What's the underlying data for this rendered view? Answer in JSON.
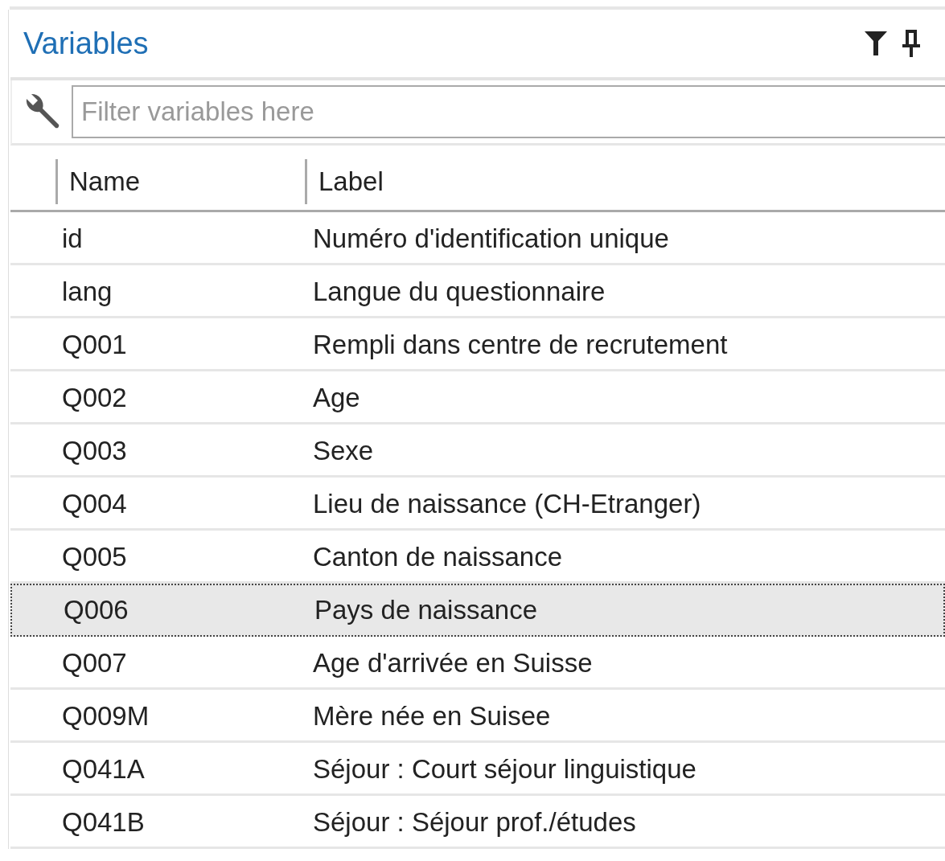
{
  "panel": {
    "title": "Variables"
  },
  "filter": {
    "placeholder": "Filter variables here"
  },
  "table": {
    "columns": [
      "Name",
      "Label"
    ],
    "rows": [
      {
        "name": "id",
        "label": "Numéro d'identification unique",
        "selected": false
      },
      {
        "name": "lang",
        "label": "Langue du questionnaire",
        "selected": false
      },
      {
        "name": "Q001",
        "label": "Rempli dans centre de recrutement",
        "selected": false
      },
      {
        "name": "Q002",
        "label": "Age",
        "selected": false
      },
      {
        "name": "Q003",
        "label": "Sexe",
        "selected": false
      },
      {
        "name": "Q004",
        "label": "Lieu de naissance (CH-Etranger)",
        "selected": false
      },
      {
        "name": "Q005",
        "label": "Canton de naissance",
        "selected": false
      },
      {
        "name": "Q006",
        "label": "Pays de naissance",
        "selected": true
      },
      {
        "name": "Q007",
        "label": "Age d'arrivée en Suisse",
        "selected": false
      },
      {
        "name": "Q009M",
        "label": "Mère née en Suisee",
        "selected": false
      },
      {
        "name": "Q041A",
        "label": "Séjour : Court séjour linguistique",
        "selected": false
      },
      {
        "name": "Q041B",
        "label": "Séjour : Séjour prof./études",
        "selected": false
      }
    ]
  }
}
